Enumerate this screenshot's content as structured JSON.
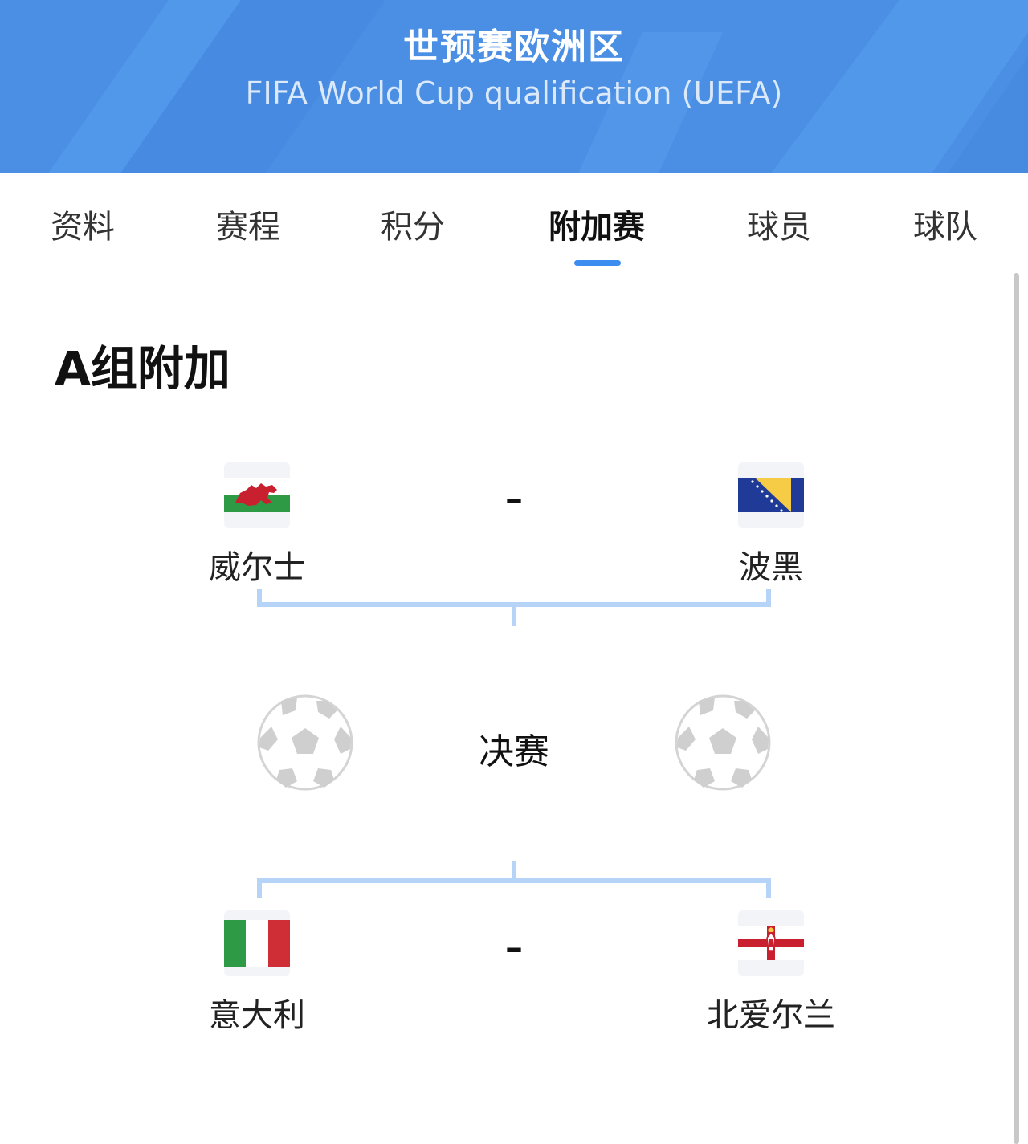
{
  "header": {
    "title_cn": "世预赛欧洲区",
    "title_en": "FIFA World Cup qualification (UEFA)",
    "background": "#4a8fe3"
  },
  "tabs": [
    {
      "label": "资料",
      "active": false
    },
    {
      "label": "赛程",
      "active": false
    },
    {
      "label": "积分",
      "active": false
    },
    {
      "label": "附加赛",
      "active": true
    },
    {
      "label": "球员",
      "active": false
    },
    {
      "label": "球队",
      "active": false
    }
  ],
  "accent": "#3b8ef0",
  "bracket_color": "#b6d4f7",
  "group": {
    "title": "A组附加",
    "semifinal_1": {
      "home": {
        "name": "威尔士",
        "flag": "wales-flag-icon"
      },
      "away": {
        "name": "波黑",
        "flag": "bosnia-flag-icon"
      },
      "score": "–"
    },
    "final": {
      "label": "决赛",
      "left_icon": "soccer-ball-icon",
      "right_icon": "soccer-ball-icon"
    },
    "semifinal_2": {
      "home": {
        "name": "意大利",
        "flag": "italy-flag-icon"
      },
      "away": {
        "name": "北爱尔兰",
        "flag": "northern-ireland-flag-icon"
      },
      "score": "–"
    }
  }
}
